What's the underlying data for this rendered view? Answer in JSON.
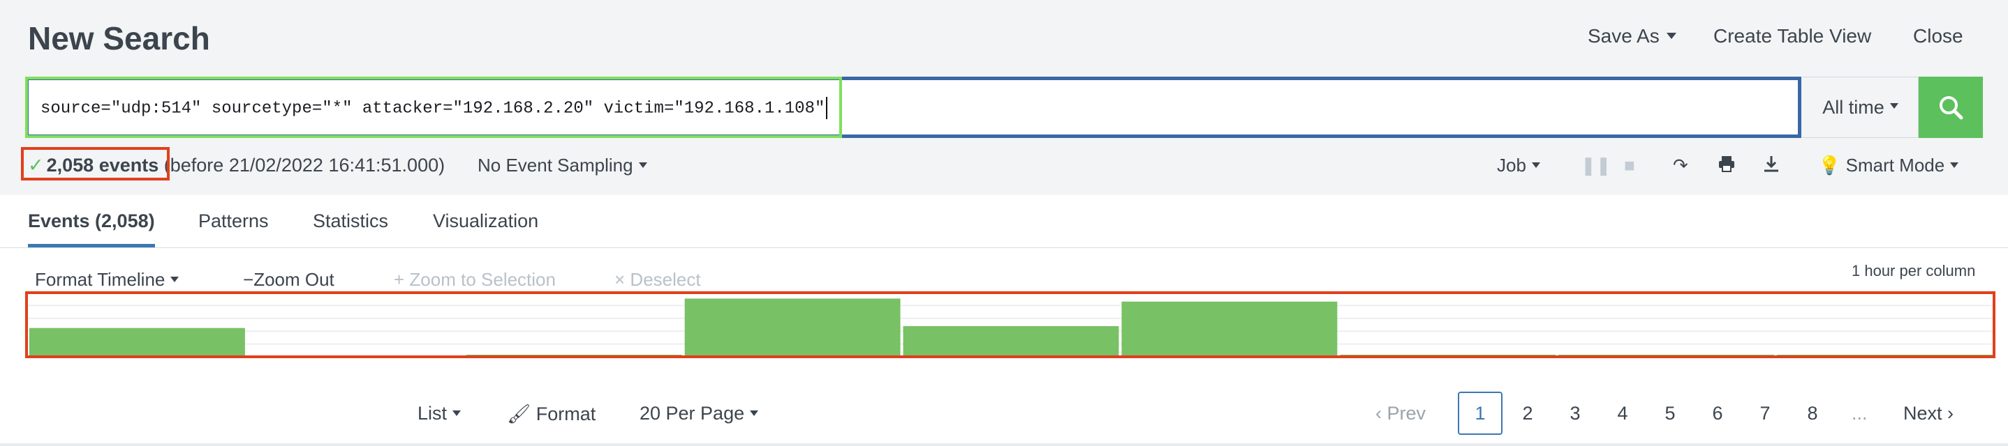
{
  "header": {
    "title": "New Search",
    "save_as": "Save As",
    "create_table_view": "Create Table View",
    "close": "Close"
  },
  "search": {
    "query": "source=\"udp:514\" sourcetype=\"*\" attacker=\"192.168.2.20\" victim=\"192.168.1.108\"",
    "time_range": "All time"
  },
  "status": {
    "events_count": "2,058 events",
    "before_text": "(before 21/02/2022 16:41:51.000)",
    "sampling": "No Event Sampling",
    "job": "Job",
    "mode": "Smart Mode"
  },
  "tabs": [
    {
      "label": "Events (2,058)"
    },
    {
      "label": "Patterns"
    },
    {
      "label": "Statistics"
    },
    {
      "label": "Visualization"
    }
  ],
  "timeline": {
    "format_label": "Format Timeline",
    "zoom_out": "Zoom Out",
    "zoom_selection": "Zoom to Selection",
    "deselect": "Deselect",
    "column_note": "1 hour per column",
    "bar_levels": [
      0.47,
      0.0,
      0.02,
      0.95,
      0.5,
      0.9,
      0.02,
      0.02,
      0.02
    ],
    "bar_color": "#78c164"
  },
  "footer": {
    "list": "List",
    "format": "Format",
    "per_page": "20 Per Page",
    "prev": "Prev",
    "pages": [
      "1",
      "2",
      "3",
      "4",
      "5",
      "6",
      "7",
      "8"
    ],
    "ellipsis": "...",
    "next": "Next"
  },
  "colors": {
    "accent": "#3c77b4",
    "search_green": "#5cc05c",
    "highlight_red": "#e0401c"
  }
}
